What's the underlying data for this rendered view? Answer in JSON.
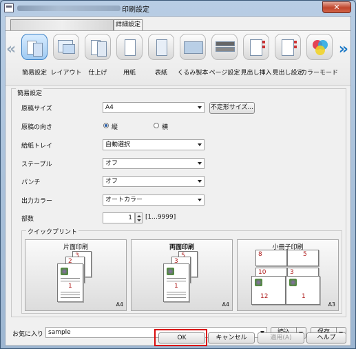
{
  "window": {
    "title": "印刷設定",
    "close_label": "✕"
  },
  "tabs": {
    "detail": "詳細設定"
  },
  "toolbar": {
    "items": [
      {
        "label": "簡易設定",
        "icon": "quick-setting-icon",
        "selected": true
      },
      {
        "label": "レイアウト",
        "icon": "layout-icon"
      },
      {
        "label": "仕上げ",
        "icon": "finishing-icon"
      },
      {
        "label": "用紙",
        "icon": "paper-icon"
      },
      {
        "label": "表紙",
        "icon": "cover-icon"
      },
      {
        "label": "くるみ製本",
        "icon": "perfect-binding-icon"
      },
      {
        "label": "ページ設定",
        "icon": "page-setting-icon"
      },
      {
        "label": "見出し挿入",
        "icon": "tab-insert-icon"
      },
      {
        "label": "見出し設定",
        "icon": "tab-setting-icon"
      },
      {
        "label": "カラーモード",
        "icon": "color-mode-icon"
      }
    ]
  },
  "quick": {
    "section_title": "簡易設定",
    "paper_size_label": "原稿サイズ",
    "paper_size_value": "A4",
    "custom_size_button": "不定形サイズ...",
    "orientation_label": "原稿の向き",
    "portrait_label": "縦",
    "landscape_label": "横",
    "tray_label": "給紙トレイ",
    "tray_value": "自動選択",
    "staple_label": "ステープル",
    "staple_value": "オフ",
    "punch_label": "パンチ",
    "punch_value": "オフ",
    "color_label": "出力カラー",
    "color_value": "オートカラー",
    "copies_label": "部数",
    "copies_value": "1",
    "copies_range": "[1...9999]"
  },
  "quick_print": {
    "title": "クイックプリント",
    "cards": [
      {
        "title": "片面印刷",
        "size": "A4",
        "numbers": [
          "3",
          "2",
          "1"
        ]
      },
      {
        "title": "両面印刷",
        "size": "A4",
        "numbers": [
          "5",
          "3",
          "1"
        ]
      },
      {
        "title": "小冊子印刷",
        "size": "A3",
        "numbers": [
          "8",
          "5",
          "10",
          "3",
          "12",
          "1"
        ]
      }
    ]
  },
  "favorites": {
    "label": "お気に入り",
    "value": "sample",
    "load_button": "読込",
    "save_button": "保存"
  },
  "footer": {
    "ok": "OK",
    "cancel": "キャンセル",
    "apply": "適用(A)",
    "help": "ヘルプ"
  }
}
